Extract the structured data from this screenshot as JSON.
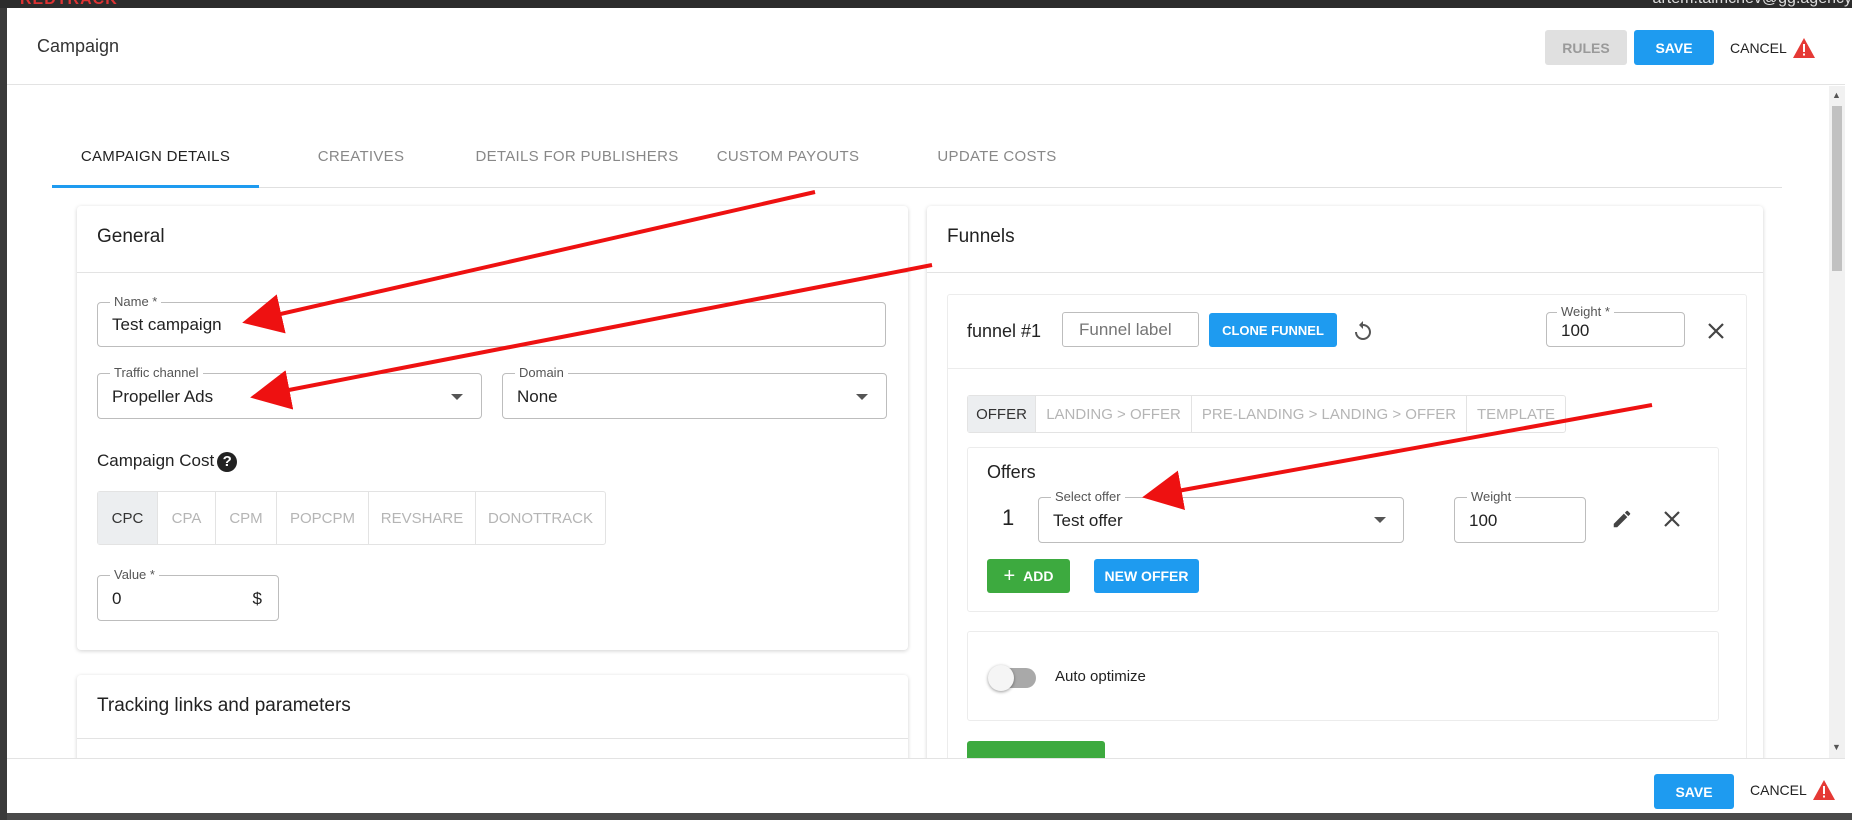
{
  "backdrop": {
    "logo": "REDTRACK",
    "user": "artem.taimchev@gg.agency"
  },
  "header": {
    "title": "Campaign",
    "rules_label": "RULES",
    "save_label": "SAVE",
    "cancel_label": "CANCEL"
  },
  "tabs": [
    {
      "label": "CAMPAIGN DETAILS",
      "active": true
    },
    {
      "label": "CREATIVES"
    },
    {
      "label": "DETAILS FOR PUBLISHERS"
    },
    {
      "label": "CUSTOM PAYOUTS"
    },
    {
      "label": "UPDATE COSTS"
    }
  ],
  "general": {
    "title": "General",
    "name": {
      "label": "Name *",
      "value": "Test campaign"
    },
    "traffic_channel": {
      "label": "Traffic channel",
      "value": "Propeller Ads"
    },
    "domain": {
      "label": "Domain",
      "value": "None"
    },
    "campaign_cost": {
      "label": "Campaign Cost",
      "options": [
        "CPC",
        "CPA",
        "CPM",
        "POPCPM",
        "REVSHARE",
        "DONOTTRACK"
      ],
      "selected": "CPC"
    },
    "value": {
      "label": "Value *",
      "value": "0",
      "suffix": "$"
    }
  },
  "tracking": {
    "title": "Tracking links and parameters"
  },
  "funnels": {
    "title": "Funnels",
    "funnel": {
      "name": "funnel #1",
      "label_placeholder": "Funnel label",
      "clone_label": "CLONE FUNNEL",
      "weight": {
        "label": "Weight *",
        "value": "100"
      },
      "modes": [
        "OFFER",
        "LANDING > OFFER",
        "PRE-LANDING > LANDING > OFFER",
        "TEMPLATE"
      ],
      "selected_mode": "OFFER",
      "offers": {
        "title": "Offers",
        "rows": [
          {
            "index": "1",
            "select_label": "Select offer",
            "offer": "Test offer",
            "weight_label": "Weight",
            "weight": "100"
          }
        ],
        "add_label": "ADD",
        "new_offer_label": "NEW OFFER"
      },
      "auto_optimize": {
        "label": "Auto optimize",
        "enabled": false
      }
    }
  },
  "footer": {
    "save_label": "SAVE",
    "cancel_label": "CANCEL"
  },
  "colors": {
    "accent": "#1e9bf0",
    "green": "#3daa3f",
    "warning": "#e53935",
    "annotation_arrow": "#ee1111"
  },
  "icons": [
    "help-icon",
    "refresh-icon",
    "close-icon",
    "pencil-icon",
    "plus-icon",
    "warning-icon",
    "caret-down-icon"
  ]
}
